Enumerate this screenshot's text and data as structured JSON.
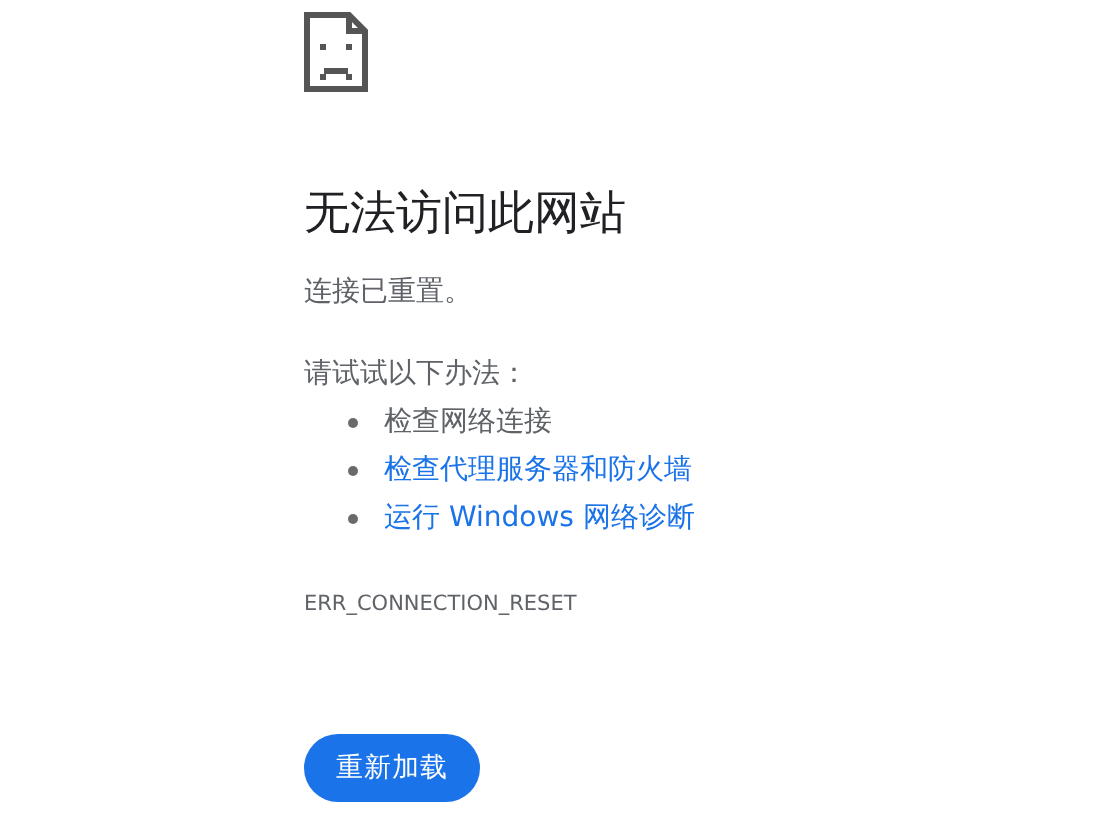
{
  "title": "无法访问此网站",
  "message": "连接已重置。",
  "suggestions_heading": "请试试以下办法：",
  "suggestions": [
    {
      "kind": "text",
      "label": "检查网络连接"
    },
    {
      "kind": "link",
      "label": "检查代理服务器和防火墙"
    },
    {
      "kind": "link",
      "label": "运行 Windows 网络诊断"
    }
  ],
  "error_code": "ERR_CONNECTION_RESET",
  "reload_button": "重新加载"
}
